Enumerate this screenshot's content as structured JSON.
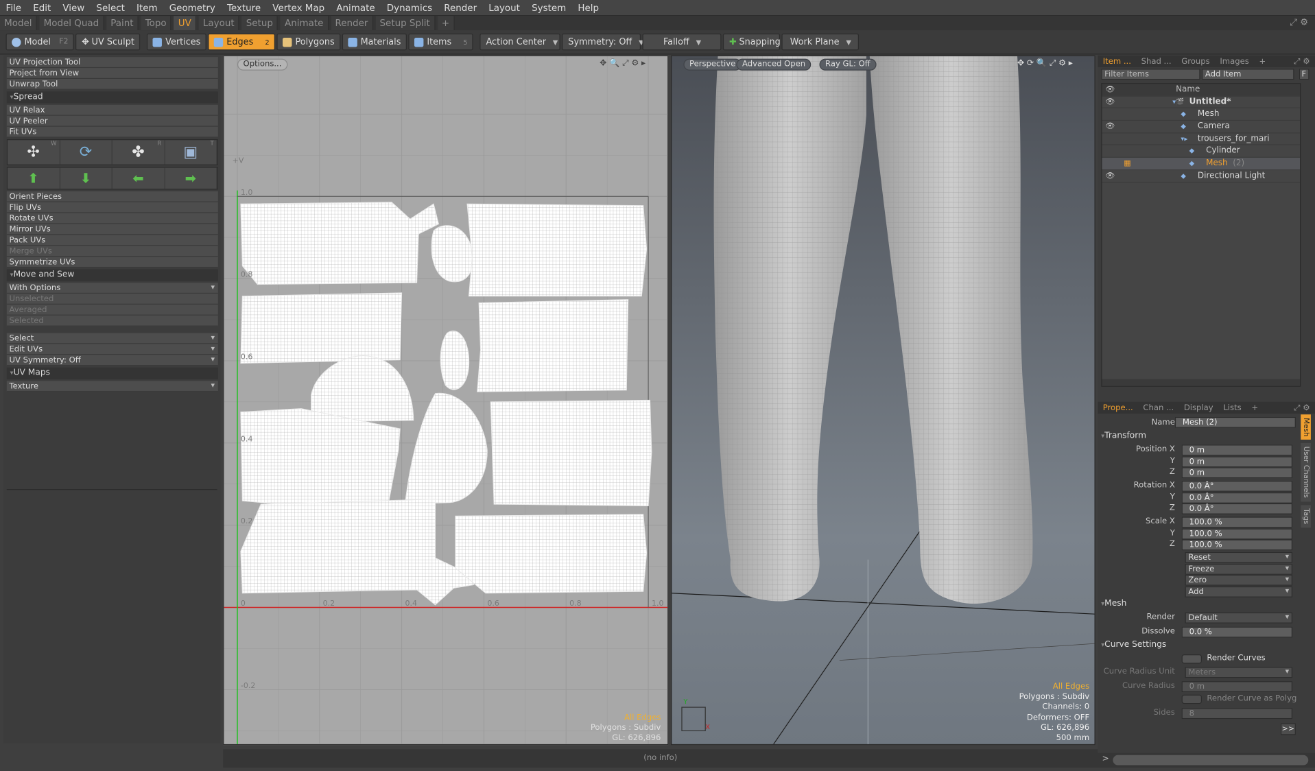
{
  "menus": [
    "File",
    "Edit",
    "View",
    "Select",
    "Item",
    "Geometry",
    "Texture",
    "Vertex Map",
    "Animate",
    "Dynamics",
    "Render",
    "Layout",
    "System",
    "Help"
  ],
  "layout_tabs": [
    "Model",
    "Model Quad",
    "Paint",
    "Topo",
    "UV",
    "Layout",
    "Setup",
    "Animate",
    "Render",
    "Setup Split",
    "+"
  ],
  "active_tab": "UV",
  "toolbar": {
    "model": "Model",
    "model_key": "F2",
    "uv_sculpt": "UV Sculpt",
    "vertices": "Vertices",
    "edges": "Edges",
    "edges_key": "2",
    "polygons": "Polygons",
    "materials": "Materials",
    "items": "Items",
    "items_key": "5",
    "action_center": "Action Center",
    "symmetry": "Symmetry: Off",
    "falloff": "Falloff",
    "snapping": "Snapping",
    "work_plane": "Work Plane"
  },
  "left_panel": {
    "tools_top": [
      "UV Projection Tool",
      "Project from View",
      "Unwrap Tool"
    ],
    "spread_title": "Spread",
    "spread_items": [
      "UV Relax",
      "UV Peeler",
      "Fit UVs"
    ],
    "icon_keys": [
      "W",
      "",
      "R",
      "T"
    ],
    "tools_mid": [
      "Orient Pieces",
      "Flip UVs",
      "Rotate UVs",
      "Mirror UVs",
      "Pack UVs",
      "Merge UVs",
      "Symmetrize UVs"
    ],
    "move_sew_title": "Move and Sew",
    "move_sew_items": [
      "With Options",
      "Unselected",
      "Averaged",
      "Selected"
    ],
    "selects": [
      "Select",
      "Edit UVs",
      "UV Symmetry: Off"
    ],
    "uv_maps_title": "UV Maps",
    "uv_map": "Texture"
  },
  "uv_view": {
    "options": "Options...",
    "axis_v": "+V",
    "ticks_x": [
      "0",
      "0.2",
      "0.4",
      "0.6",
      "0.8",
      "1.0"
    ],
    "ticks_y": [
      "1.0",
      "0.8",
      "0.6",
      "0.4",
      "0.2",
      "-0.2"
    ],
    "stat_mode": "All Edges",
    "stat_polys": "Polygons : Subdiv",
    "stat_gl": "GL: 626,896"
  },
  "view3d": {
    "perspective": "Perspective",
    "advanced": "Advanced Open",
    "raygl": "Ray GL: Off",
    "stats": [
      "All Edges",
      "Polygons : Subdiv",
      "Channels: 0",
      "Deformers: OFF",
      "GL: 626,896",
      "500 mm"
    ]
  },
  "item_panel": {
    "tabs": [
      "Item ...",
      "Shad ...",
      "Groups",
      "Images",
      "+"
    ],
    "filter": "Filter Items",
    "add_item": "Add Item",
    "f_btn": "F",
    "col_name": "Name",
    "items": [
      {
        "label": "Untitled*",
        "indent": 0
      },
      {
        "label": "Mesh",
        "indent": 1
      },
      {
        "label": "Camera",
        "indent": 1
      },
      {
        "label": "trousers_for_mari",
        "indent": 1
      },
      {
        "label": "Cylinder",
        "indent": 2
      },
      {
        "label": "Mesh",
        "suffix": "(2)",
        "indent": 2
      },
      {
        "label": "Directional Light",
        "indent": 1
      }
    ]
  },
  "properties": {
    "tabs": [
      "Prope...",
      "Chan ...",
      "Display",
      "Lists",
      "+"
    ],
    "side_tabs": [
      "Mesh",
      "User Channels",
      "Tags"
    ],
    "name_label": "Name",
    "name_value": "Mesh (2)",
    "transform_title": "Transform",
    "position_label": "Position X",
    "rotation_label": "Rotation X",
    "scale_label": "Scale X",
    "y": "Y",
    "z": "Z",
    "position": [
      "0 m",
      "0 m",
      "0 m"
    ],
    "rotation": [
      "0.0 Â°",
      "0.0 Â°",
      "0.0 Â°"
    ],
    "scale": [
      "100.0 %",
      "100.0 %",
      "100.0 %"
    ],
    "actions": [
      "Reset",
      "Freeze",
      "Zero",
      "Add"
    ],
    "mesh_title": "Mesh",
    "render_label": "Render",
    "render_value": "Default",
    "dissolve_label": "Dissolve",
    "dissolve_value": "0.0 %",
    "curve_title": "Curve Settings",
    "render_curves": "Render Curves",
    "curve_radius_unit_label": "Curve Radius Unit",
    "curve_radius_unit": "Meters",
    "curve_radius_label": "Curve Radius",
    "curve_radius": "0 m",
    "render_curve_poly": "Render Curve as Polyg ...",
    "sides_label": "Sides",
    "sides": "8",
    "more": ">>"
  },
  "status": {
    "info": "(no info)",
    "prompt": ">"
  },
  "colors": {
    "accent": "#f0a030",
    "uv_bg": "#a8a8a8",
    "axis_u": "#d02020",
    "axis_v": "#20c020"
  }
}
